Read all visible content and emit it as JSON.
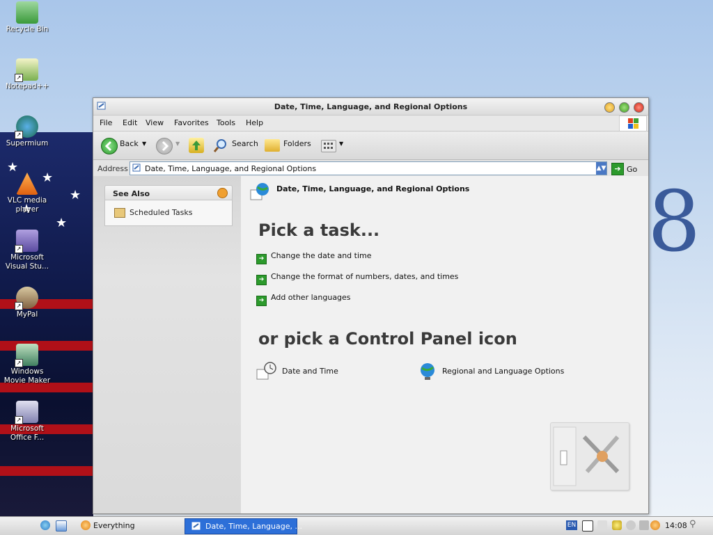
{
  "desktop": {
    "icons": [
      {
        "label": "Recycle Bin"
      },
      {
        "label": "Notepad++"
      },
      {
        "label": "Supermium"
      },
      {
        "label": "VLC media player"
      },
      {
        "label": "Microsoft Visual Stu..."
      },
      {
        "label": "MyPal"
      },
      {
        "label": "Windows Movie Maker"
      },
      {
        "label": "Microsoft Office F..."
      }
    ]
  },
  "window": {
    "title": "Date, Time, Language, and Regional Options",
    "menu": [
      "File",
      "Edit",
      "View",
      "Favorites",
      "Tools",
      "Help"
    ],
    "toolbar": {
      "back": "Back",
      "search": "Search",
      "folders": "Folders"
    },
    "address": {
      "label": "Address",
      "value": "Date, Time, Language, and Regional Options",
      "go": "Go"
    },
    "see_also": {
      "title": "See Also",
      "items": [
        "Scheduled Tasks"
      ]
    },
    "category_title": "Date, Time, Language, and Regional Options",
    "pick_task": "Pick a task...",
    "tasks": [
      "Change the date and time",
      "Change the format of numbers, dates, and times",
      "Add other languages"
    ],
    "or_pick": "or pick a Control Panel icon",
    "cpl_icons": [
      "Date and Time",
      "Regional and Language Options"
    ]
  },
  "taskbar": {
    "everything": "Everything",
    "active_window": "Date, Time, Language, ...",
    "lang": "EN",
    "clock": "14:08"
  },
  "colors": {
    "accent": "#2d6fd8",
    "go_green": "#2c9a2c"
  }
}
